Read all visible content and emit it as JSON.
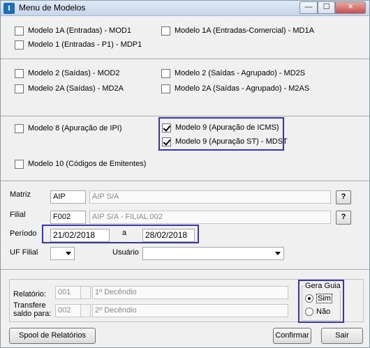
{
  "window": {
    "title": "Menu de Modelos",
    "icon_letter": "I"
  },
  "models": {
    "mod1": {
      "label": "Modelo 1A (Entradas) - MOD1",
      "checked": false
    },
    "md1a": {
      "label": "Modelo 1A (Entradas-Comercial) - MD1A",
      "checked": false
    },
    "mdp1": {
      "label": "Modelo 1 (Entradas - P1) - MDP1",
      "checked": false
    },
    "mod2": {
      "label": "Modelo 2 (Saídas) - MOD2",
      "checked": false
    },
    "md2s": {
      "label": "Modelo 2 (Saídas - Agrupado) - MD2S",
      "checked": false
    },
    "md2a": {
      "label": "Modelo 2A (Saídas) - MD2A",
      "checked": false
    },
    "m2as": {
      "label": "Modelo 2A (Saídas - Agrupado) - M2AS",
      "checked": false
    },
    "mod8": {
      "label": "Modelo 8 (Apuração de IPI)",
      "checked": false
    },
    "mod9_icms": {
      "label": "Modelo 9 (Apuração de ICMS)",
      "checked": true
    },
    "mod9_st": {
      "label": "Modelo 9 (Apuração ST) - MDST",
      "checked": true
    },
    "mod10": {
      "label": "Modelo 10 (Códigos de Emitentes)",
      "checked": false
    }
  },
  "form": {
    "matriz_label": "Matriz",
    "matriz_code": "AIP",
    "matriz_name": "AIP S/A",
    "filial_label": "Filial",
    "filial_code": "F002",
    "filial_name": "AIP S/A - FILIAL 002",
    "lookup_label": "?",
    "periodo_label": "Período",
    "periodo_start": "21/02/2018",
    "periodo_sep": "a",
    "periodo_end": "28/02/2018",
    "uf_label": "UF Filial",
    "uf_value": "",
    "usuario_label": "Usuário",
    "usuario_value": ""
  },
  "report": {
    "relatorio_label": "Relatório:",
    "relatorio_code": "001",
    "relatorio_desc": "1º Decêndio",
    "transfere_label_1": "Transfere",
    "transfere_label_2": "saldo para:",
    "transfere_code": "002",
    "transfere_desc": "2º Decêndio"
  },
  "gera_guia": {
    "title": "Gera Guia",
    "options": [
      "Sim",
      "Não"
    ],
    "selected": "Sim"
  },
  "buttons": {
    "spool": "Spool de Relatórios",
    "confirmar": "Confirmar",
    "sair": "Sair"
  }
}
